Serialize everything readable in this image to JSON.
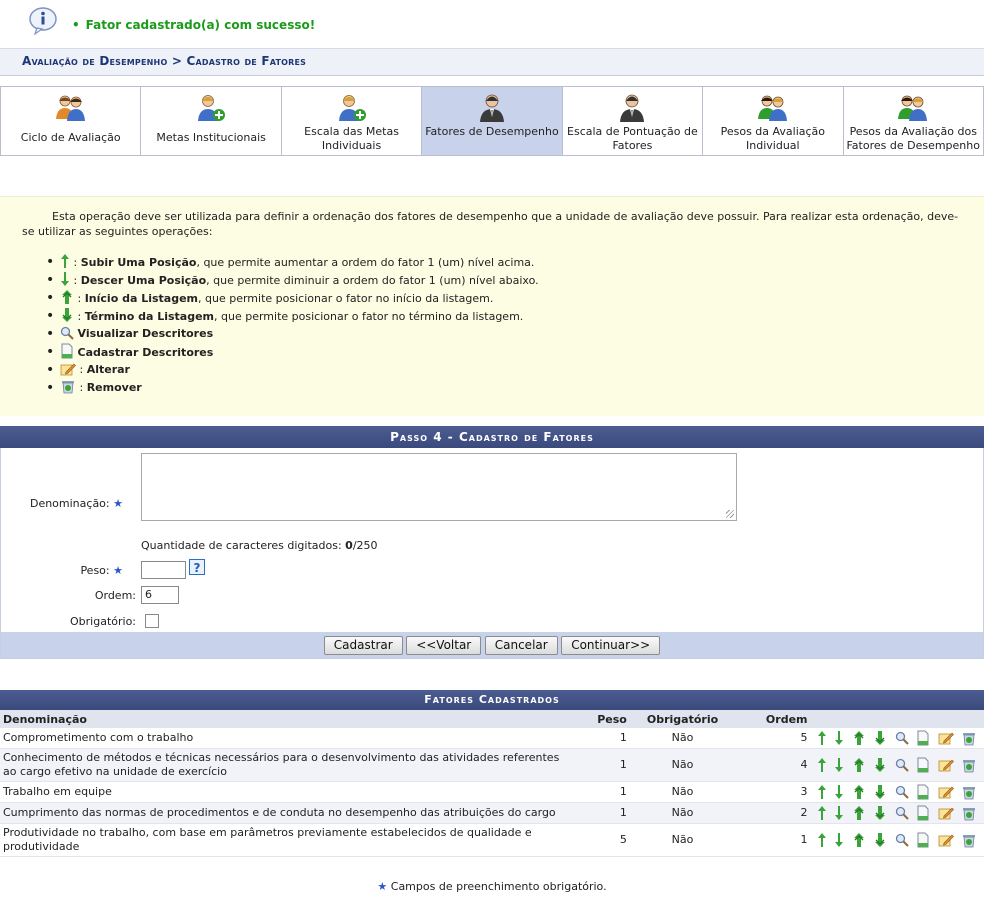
{
  "message": {
    "text": "Fator cadastrado(a) com sucesso!"
  },
  "breadcrumb": {
    "text": "Avaliação de Desempenho > Cadastro de Fatores"
  },
  "tabs": [
    {
      "label": "Ciclo de Avaliação",
      "active": false
    },
    {
      "label": "Metas Institucionais",
      "active": false
    },
    {
      "label": "Escala das Metas Individuais",
      "active": false
    },
    {
      "label": "Fatores de Desempenho",
      "active": true
    },
    {
      "label": "Escala de Pontuação de Fatores",
      "active": false
    },
    {
      "label": "Pesos da Avaliação Individual",
      "active": false
    },
    {
      "label": "Pesos da Avaliação dos Fatores de Desempenho",
      "active": false
    }
  ],
  "instructions": {
    "intro": "Esta operação deve ser utilizada para definir a ordenação dos fatores de desempenho que a unidade de avaliação deve possuir. Para realizar esta ordenação, deve-se utilizar as seguintes operações:",
    "items": [
      {
        "icon": "arrow-up-icon",
        "label": "Subir Uma Posição",
        "desc": ", que permite aumentar a ordem do fator 1 (um) nível acima."
      },
      {
        "icon": "arrow-down-icon",
        "label": "Descer Uma Posição",
        "desc": ", que permite diminuir a ordem do fator 1 (um) nível abaixo."
      },
      {
        "icon": "arrow-top-icon",
        "label": "Início da Listagem",
        "desc": ", que permite posicionar o fator no início da listagem."
      },
      {
        "icon": "arrow-bottom-icon",
        "label": "Término da Listagem",
        "desc": ", que permite posicionar o fator no término da listagem."
      },
      {
        "icon": "magnifier-icon",
        "label": "Visualizar Descritores",
        "desc": ""
      },
      {
        "icon": "document-icon",
        "label": "Cadastrar Descritores",
        "desc": ""
      },
      {
        "icon": "edit-icon",
        "label": "Alterar",
        "desc": ""
      },
      {
        "icon": "trash-icon",
        "label": "Remover",
        "desc": ""
      }
    ]
  },
  "form": {
    "caption": "Passo 4 - Cadastro de Fatores",
    "denominacao_label": "Denominação:",
    "count_label": "Quantidade de caracteres digitados: ",
    "count_value": "0",
    "count_max": "/250",
    "peso_label": "Peso:",
    "peso_value": "",
    "help_label": "?",
    "ordem_label": "Ordem:",
    "ordem_value": "6",
    "obrigatorio_label": "Obrigatório:",
    "buttons": {
      "cadastrar": "Cadastrar",
      "voltar": "<<Voltar",
      "cancelar": "Cancelar",
      "continuar": "Continuar>>"
    }
  },
  "list": {
    "caption": "Fatores Cadastrados",
    "headers": {
      "denominacao": "Denominação",
      "peso": "Peso",
      "obrigatorio": "Obrigatório",
      "ordem": "Ordem"
    },
    "rows": [
      {
        "denominacao": "Comprometimento com o trabalho",
        "peso": "1",
        "obrigatorio": "Não",
        "ordem": "5"
      },
      {
        "denominacao": "Conhecimento de métodos e técnicas necessários para o desenvolvimento das atividades referentes ao cargo efetivo na unidade de exercício",
        "peso": "1",
        "obrigatorio": "Não",
        "ordem": "4"
      },
      {
        "denominacao": "Trabalho em equipe",
        "peso": "1",
        "obrigatorio": "Não",
        "ordem": "3"
      },
      {
        "denominacao": "Cumprimento das normas de procedimentos e de conduta no desempenho das atribuições do cargo",
        "peso": "1",
        "obrigatorio": "Não",
        "ordem": "2"
      },
      {
        "denominacao": "Produtividade no trabalho, com base em parâmetros previamente estabelecidos de qualidade e produtividade",
        "peso": "5",
        "obrigatorio": "Não",
        "ordem": "1"
      }
    ]
  },
  "footer": {
    "star": "★",
    "text": " Campos de preenchimento obrigatório."
  },
  "colors": {
    "header_blue": "#3b4a7d",
    "success_green": "#1a9c1a",
    "tab_active": "#c8d2ea",
    "instructions_bg": "#fdfde4"
  }
}
